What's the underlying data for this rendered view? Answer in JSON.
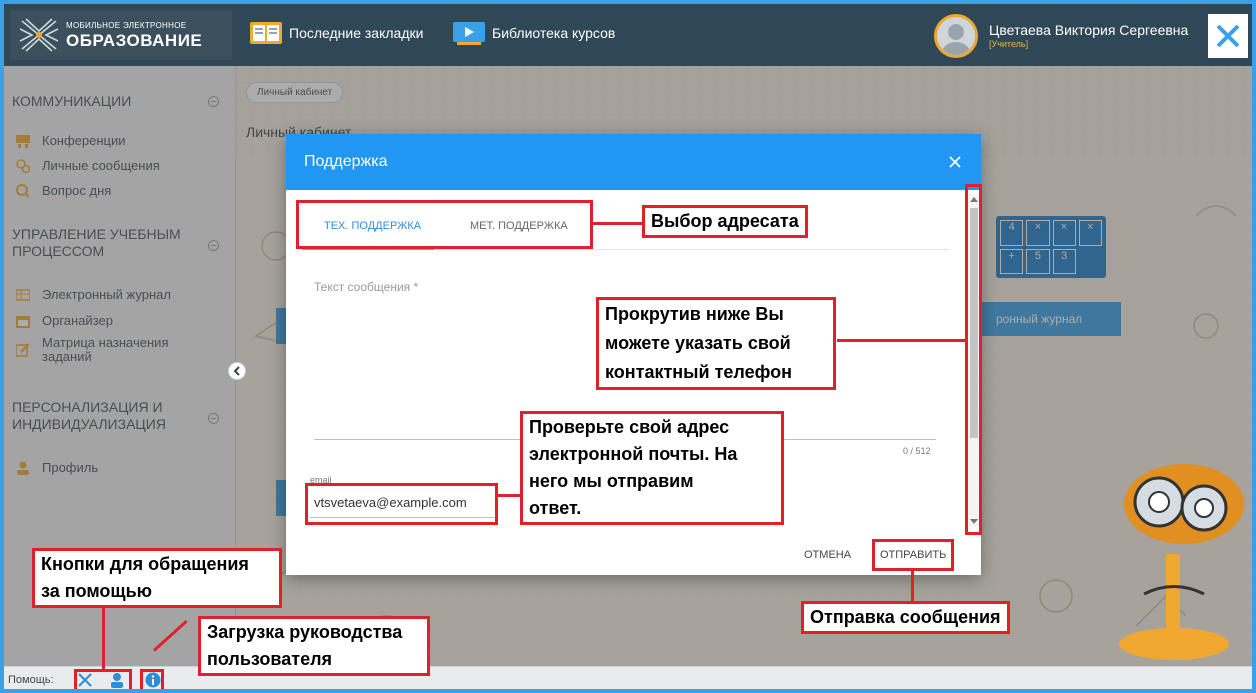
{
  "header": {
    "logo_small": "МОБИЛЬНОЕ ЭЛЕКТРОННОЕ",
    "logo_big": "ОБРАЗОВАНИЕ",
    "nav": [
      "Последние закладки",
      "Библиотека курсов"
    ],
    "user_name": "Цветаева Виктория Сергеевна",
    "user_role": "[Учитель]"
  },
  "sidebar": {
    "sections": [
      {
        "title": "КОММУНИКАЦИИ",
        "items": [
          "Конференции",
          "Личные сообщения",
          "Вопрос дня"
        ]
      },
      {
        "title_lines": [
          "УПРАВЛЕНИЕ УЧЕБНЫМ",
          "ПРОЦЕССОМ"
        ],
        "items": [
          "Электронный журнал",
          "Органайзер",
          "Матрица назначения заданий"
        ]
      },
      {
        "title_lines": [
          "ПЕРСОНАЛИЗАЦИЯ И",
          "ИНДИВИДУАЛИЗАЦИЯ"
        ],
        "items": [
          "Профиль"
        ]
      }
    ],
    "matrix_lines": [
      "Матрица назначения",
      "заданий"
    ]
  },
  "main": {
    "breadcrumb": "Личный кабинет",
    "page_title": "Личный кабинет",
    "tile_label": "ронный журнал",
    "tile_glyphs": [
      "4",
      "×",
      "×",
      "×",
      "+",
      "5",
      "3"
    ]
  },
  "modal": {
    "title": "Поддержка",
    "tabs": [
      "ТЕХ. ПОДДЕРЖКА",
      "МЕТ. ПОДДЕРЖКА"
    ],
    "active_tab": 0,
    "message_placeholder": "Текст сообщения *",
    "counter": "0 / 512",
    "email_label": "email",
    "email_value": "vtsvetaeva@example.com",
    "cancel_label": "ОТМЕНА",
    "send_label": "ОТПРАВИТЬ"
  },
  "footer": {
    "help_label": "Помощь:"
  },
  "annotations": {
    "recipient": "Выбор адресата",
    "scroll": [
      "Прокрутив ниже Вы",
      "можете указать свой",
      "контактный телефон"
    ],
    "email": [
      "Проверьте свой адрес",
      "электронной почты. На",
      "него мы отправим",
      "ответ."
    ],
    "help_buttons": [
      "Кнопки для обращения",
      "за помощью"
    ],
    "manual": [
      "Загрузка руководства",
      "пользователя"
    ],
    "send": "Отправка сообщения"
  },
  "colors": {
    "topbar": "#2f4858",
    "modal_header": "#2196f3",
    "callout_border": "#e0202a",
    "tab_active_underline": "#68c06a",
    "accent": "#2f8fd8"
  }
}
